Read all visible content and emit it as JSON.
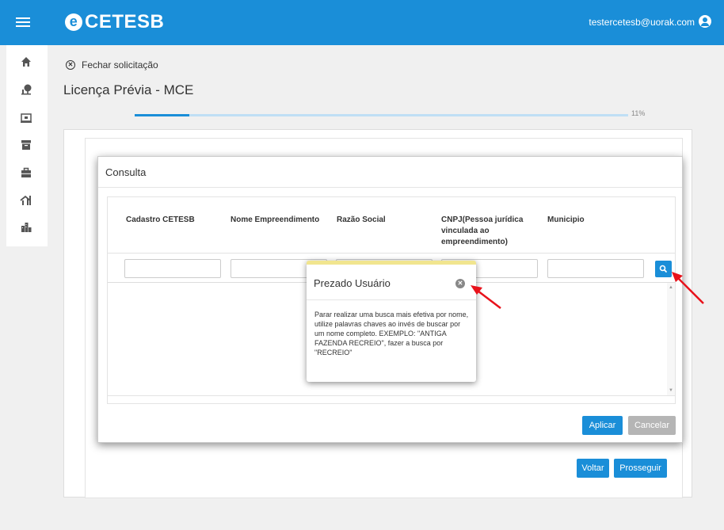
{
  "header": {
    "brand": "CETESB",
    "brand_mark": "e",
    "user_email": "testercetesb@uorak.com",
    "accent": "#1a8ed8"
  },
  "sidebar": {
    "items": [
      {
        "icon": "home-icon"
      },
      {
        "icon": "tree-icon"
      },
      {
        "icon": "screen-icon"
      },
      {
        "icon": "archive-icon"
      },
      {
        "icon": "briefcase-icon"
      },
      {
        "icon": "house-key-icon"
      },
      {
        "icon": "buildings-icon"
      }
    ]
  },
  "page": {
    "close_label": "Fechar solicitação",
    "title": "Licença Prévia - MCE",
    "progress_label": "11%",
    "progress": 0.11
  },
  "actions": {
    "back": "Voltar",
    "proceed": "Prosseguir"
  },
  "consulta": {
    "title": "Consulta",
    "columns": [
      "Cadastro CETESB",
      "Nome Empreendimento",
      "Razão Social",
      "CNPJ(Pessoa jurídica vinculada ao empreendimento)",
      "Municipio"
    ],
    "filters": [
      "",
      "",
      "",
      "",
      ""
    ],
    "apply": "Aplicar",
    "cancel": "Cancelar"
  },
  "popover": {
    "title": "Prezado Usuário",
    "body": "Parar realizar uma busca mais efetiva por nome, utilize palavras chaves ao invés de buscar por um nome completo. EXEMPLO: \"ANTIGA FAZENDA RECREIO\", fazer a busca por \"RECREIO\"",
    "border_color": "#f1e58f"
  },
  "annotation_color": "#e8121b"
}
